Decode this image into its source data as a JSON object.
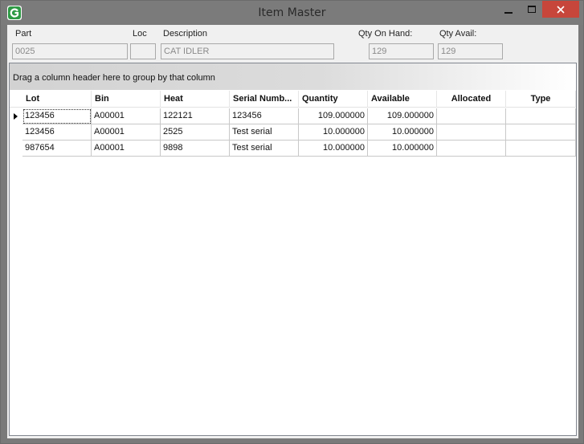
{
  "window": {
    "title": "Item Master",
    "minimize_glyph": "🗕",
    "maximize_glyph": "☐",
    "close_glyph": "✕",
    "app_icon": "green-g-logo-icon",
    "close_color": "#c7463b"
  },
  "form": {
    "part_label": "Part",
    "part_value": "0025",
    "loc_label": "Loc",
    "loc_value": "",
    "description_label": "Description",
    "description_value": "CAT IDLER",
    "qty_on_hand_label": "Qty On Hand:",
    "qty_on_hand_value": "129",
    "qty_avail_label": "Qty Avail:",
    "qty_avail_value": "129"
  },
  "grid": {
    "group_panel_text": "Drag a column header here to group by that column",
    "columns": [
      "Lot",
      "Bin",
      "Heat",
      "Serial Numb...",
      "Quantity",
      "Available",
      "Allocated",
      "Type"
    ],
    "rows": [
      [
        "123456",
        "A00001",
        "122121",
        "123456",
        "109.000000",
        "109.000000",
        "",
        ""
      ],
      [
        "123456",
        "A00001",
        "2525",
        "Test serial",
        "10.000000",
        "10.000000",
        "",
        ""
      ],
      [
        "987654",
        "A00001",
        "9898",
        "Test serial",
        "10.000000",
        "10.000000",
        "",
        ""
      ]
    ]
  }
}
